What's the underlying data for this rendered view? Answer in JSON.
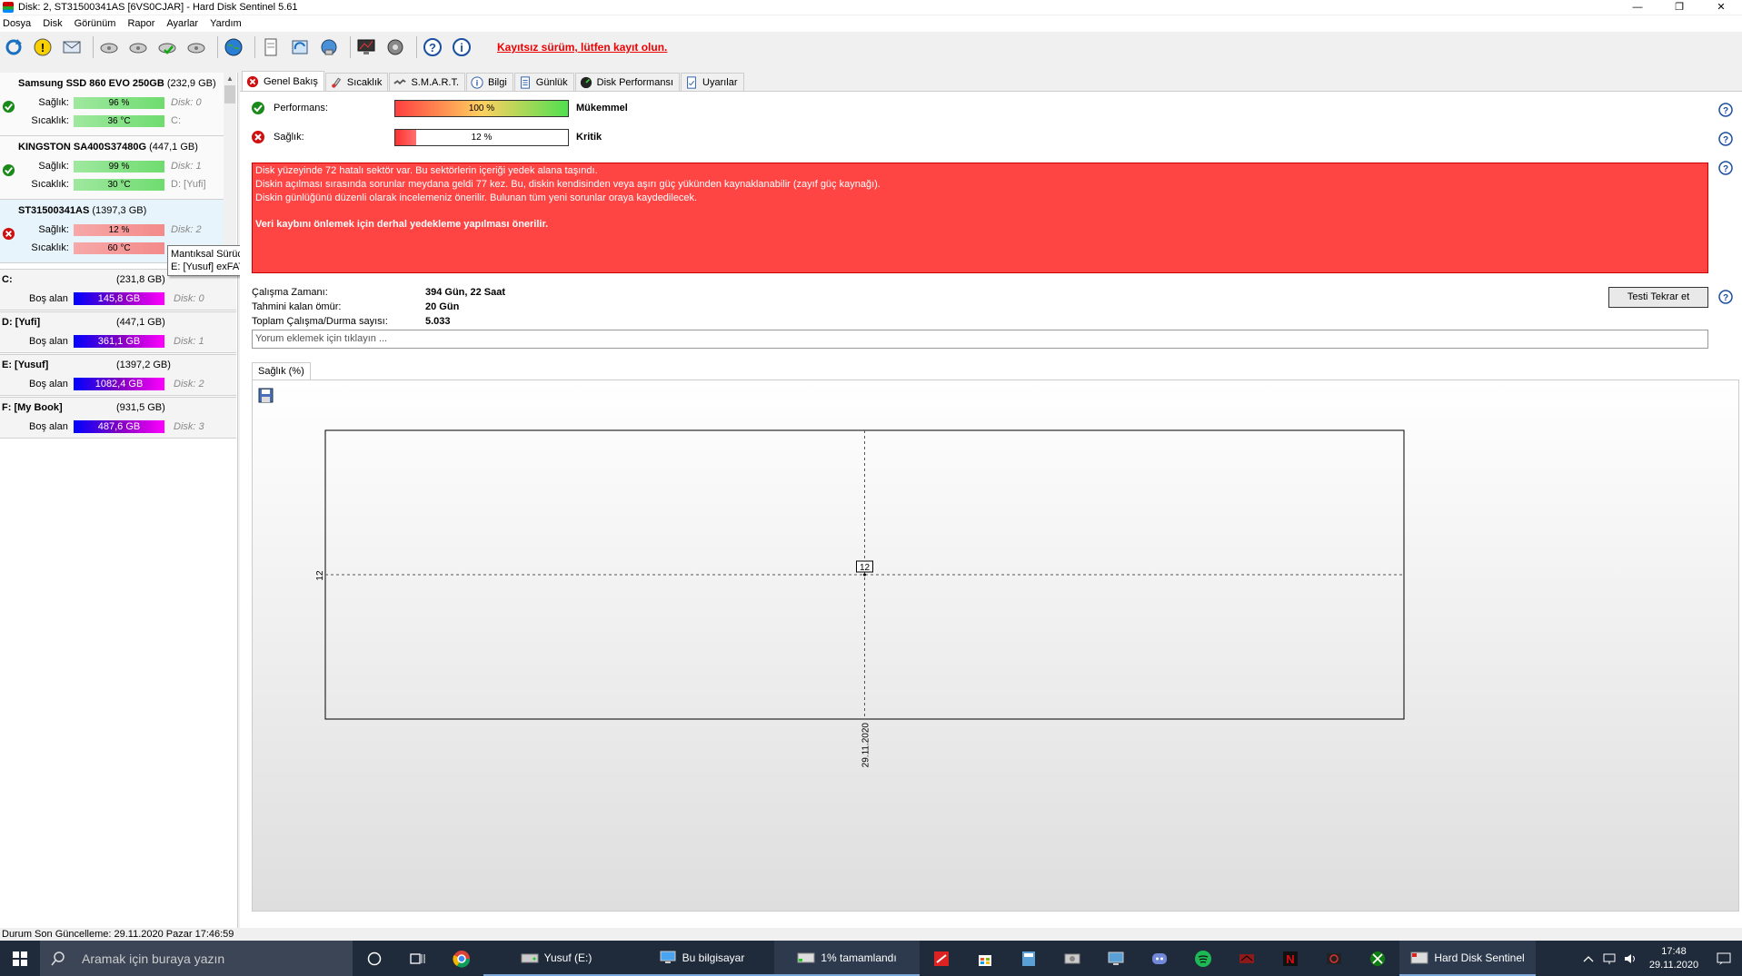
{
  "window": {
    "title": "Disk: 2, ST31500341AS [6VS0CJAR]  -  Hard Disk Sentinel 5.61",
    "minimize": "—",
    "maximize": "❐",
    "close": "✕"
  },
  "menu": [
    "Dosya",
    "Disk",
    "Görünüm",
    "Rapor",
    "Ayarlar",
    "Yardım"
  ],
  "toolbar": {
    "unregistered_text": "Kayıtsız sürüm, lütfen kayıt olun."
  },
  "disks": [
    {
      "name": "Samsung SSD 860 EVO 250GB",
      "size": "(232,9 GB)",
      "health_label": "Sağlık:",
      "health": "96 %",
      "health_value": 96,
      "temp_label": "Sıcaklık:",
      "temp": "36 °C",
      "disk": "Disk: 0",
      "drive": "C:",
      "status": "ok"
    },
    {
      "name": "KINGSTON SA400S37480G",
      "size": "(447,1 GB)",
      "health_label": "Sağlık:",
      "health": "99 %",
      "health_value": 99,
      "temp_label": "Sıcaklık:",
      "temp": "30 °C",
      "disk": "Disk: 1",
      "drive": "D: [Yufi]",
      "status": "ok"
    },
    {
      "name": "ST31500341AS",
      "size": "(1397,3 GB)",
      "health_label": "Sağlık:",
      "health": "12 %",
      "health_value": 12,
      "temp_label": "Sıcaklık:",
      "temp": "60 °C",
      "disk": "Disk: 2",
      "drive": "",
      "status": "critical"
    }
  ],
  "tooltip": {
    "line1": "Mantıksal Sürücü(ler)",
    "line2": "E: [Yusuf] exFAT"
  },
  "volumes": [
    {
      "name": "C:",
      "size": "(231,8 GB)",
      "free_label": "Boş alan",
      "free": "145,8 GB",
      "disk": "Disk: 0"
    },
    {
      "name": "D: [Yufi]",
      "size": "(447,1 GB)",
      "free_label": "Boş alan",
      "free": "361,1 GB",
      "disk": "Disk: 1"
    },
    {
      "name": "E: [Yusuf]",
      "size": "(1397,2 GB)",
      "free_label": "Boş alan",
      "free": "1082,4 GB",
      "disk": "Disk: 2"
    },
    {
      "name": "F: [My Book]",
      "size": "(931,5 GB)",
      "free_label": "Boş alan",
      "free": "487,6 GB",
      "disk": "Disk: 3"
    }
  ],
  "tabs": [
    "Genel Bakış",
    "Sıcaklık",
    "S.M.A.R.T.",
    "Bilgi",
    "Günlük",
    "Disk Performansı",
    "Uyarılar"
  ],
  "overview": {
    "performance_label": "Performans:",
    "performance": "100 %",
    "performance_value": 100,
    "performance_rating": "Mükemmel",
    "health_label": "Sağlık:",
    "health": "12 %",
    "health_value": 12,
    "health_rating": "Kritik",
    "alert_lines": [
      "Disk yüzeyinde 72 hatalı sektör var. Bu sektörlerin içeriği yedek alana taşındı.",
      "Diskin açılması sırasında sorunlar meydana geldi 77 kez. Bu, diskin kendisinden veya aşırı güç yükünden kaynaklanabilir (zayıf güç kaynağı).",
      "Diskin günlüğünü düzenli olarak incelemeniz önerilir. Bulunan tüm yeni sorunlar oraya kaydedilecek."
    ],
    "alert_bold": "Veri kaybını önlemek için derhal yedekleme yapılması önerilir.",
    "uptime_label": "Çalışma Zamanı:",
    "uptime": "394 Gün, 22 Saat",
    "remaining_label": "Tahmini kalan ömür:",
    "remaining": "20 Gün",
    "startstop_label": "Toplam Çalışma/Durma sayısı:",
    "startstop": "5.033",
    "retest_button": "Testi Tekrar et",
    "comment_placeholder": "Yorum eklemek için tıklayın ...",
    "chart_tab": "Sağlık (%)"
  },
  "chart_data": {
    "type": "line",
    "title": "Sağlık (%)",
    "x": [
      "29.11.2020"
    ],
    "series": [
      {
        "values": [
          12
        ]
      }
    ],
    "yticks": [
      "12"
    ],
    "data_labels": [
      "12"
    ],
    "grid": true
  },
  "statusbar": "Durum Son Güncelleme: 29.11.2020 Pazar 17:46:59",
  "taskbar": {
    "search_placeholder": "Aramak için buraya yazın",
    "apps": [
      "Yusuf (E:)",
      "Bu bilgisayar",
      "1% tamamlandı",
      "Hard Disk Sentinel"
    ],
    "time": "17:48",
    "date": "29.11.2020"
  },
  "colors": {
    "alert_bg": "#ff4444",
    "unregistered": "#e00000",
    "taskbar": "#1f2a3a"
  }
}
